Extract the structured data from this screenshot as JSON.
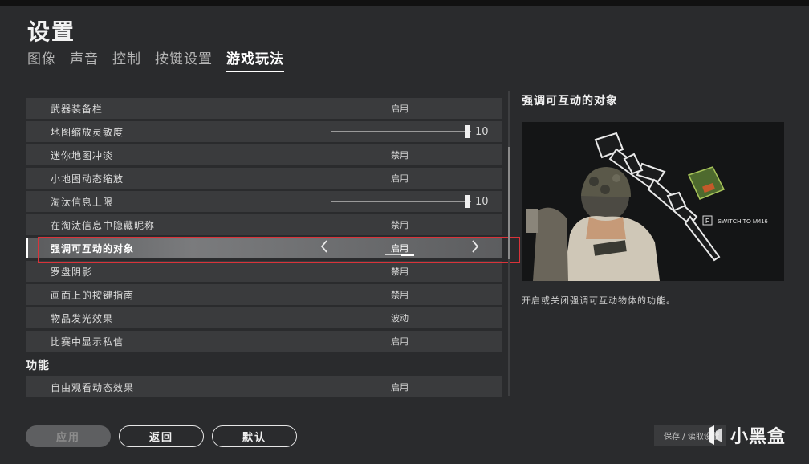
{
  "title": "设置",
  "tabs": [
    {
      "label": "图像",
      "active": false
    },
    {
      "label": "声音",
      "active": false
    },
    {
      "label": "控制",
      "active": false
    },
    {
      "label": "按键设置",
      "active": false
    },
    {
      "label": "游戏玩法",
      "active": true
    }
  ],
  "settings": [
    {
      "label": "武器装备栏",
      "type": "toggle",
      "value": "启用"
    },
    {
      "label": "地图缩放灵敏度",
      "type": "slider",
      "value": "10",
      "level": 1.0
    },
    {
      "label": "迷你地图冲淡",
      "type": "toggle",
      "value": "禁用"
    },
    {
      "label": "小地图动态缩放",
      "type": "toggle",
      "value": "启用"
    },
    {
      "label": "淘汰信息上限",
      "type": "slider",
      "value": "10",
      "level": 1.0
    },
    {
      "label": "在淘汰信息中隐藏昵称",
      "type": "toggle",
      "value": "禁用"
    },
    {
      "label": "强调可互动的对象",
      "type": "toggle",
      "value": "启用",
      "selected": true
    },
    {
      "label": "罗盘阴影",
      "type": "toggle",
      "value": "禁用"
    },
    {
      "label": "画面上的按键指南",
      "type": "toggle",
      "value": "禁用"
    },
    {
      "label": "物品发光效果",
      "type": "toggle",
      "value": "波动"
    },
    {
      "label": "比赛中显示私信",
      "type": "toggle",
      "value": "启用"
    }
  ],
  "section2": {
    "header": "功能",
    "items": [
      {
        "label": "自由观看动态效果",
        "type": "toggle",
        "value": "启用"
      }
    ]
  },
  "detail": {
    "title": "强调可互动的对象",
    "image_caption": "SWITCH TO M416",
    "image_key": "F",
    "description": "开启或关闭强调可互动物体的功能。"
  },
  "buttons": {
    "apply": "应用",
    "back": "返回",
    "default": "默认"
  },
  "save_label": "保存 / 读取设置",
  "watermark": "小黑盒",
  "colors": {
    "highlight_border": "#d9333a",
    "background": "#2a2b2d",
    "row": "#3a3b3d"
  }
}
